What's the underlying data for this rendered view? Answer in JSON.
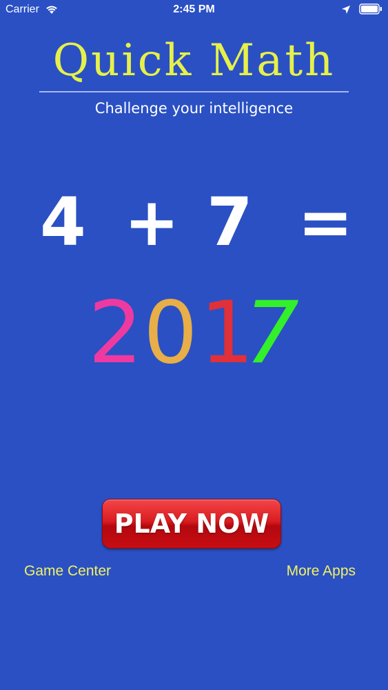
{
  "status_bar": {
    "carrier": "Carrier",
    "time": "2:45 PM"
  },
  "icons": {
    "wifi": "wifi-icon",
    "location": "location-arrow-icon",
    "battery": "battery-icon"
  },
  "app": {
    "title": "Quick Math",
    "subtitle": "Challenge your intelligence"
  },
  "equation": {
    "a": "4",
    "operator": "+",
    "b": "7",
    "equals": "="
  },
  "year": {
    "digits": [
      "2",
      "0",
      "1",
      "7"
    ],
    "colors": [
      "#ee3aa0",
      "#e8ae48",
      "#e0303a",
      "#33f02a"
    ]
  },
  "actions": {
    "play": "PLAY NOW",
    "game_center": "Game Center",
    "more_apps": "More Apps"
  },
  "colors": {
    "background": "#2a50c4",
    "title": "#e6f04a",
    "link": "#f2f262",
    "button": "#d91d22"
  }
}
